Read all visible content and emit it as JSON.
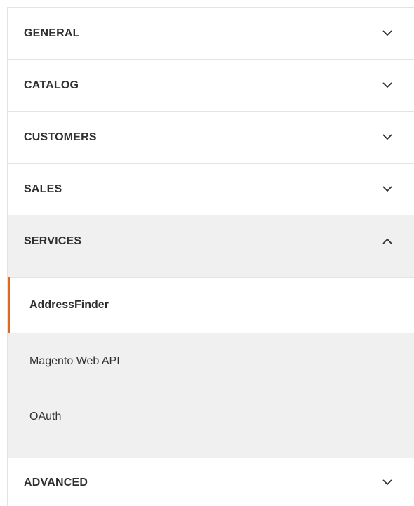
{
  "sections": [
    {
      "label": "GENERAL",
      "chevron": "chevron-down-icon"
    },
    {
      "label": "CATALOG",
      "chevron": "chevron-down-icon"
    },
    {
      "label": "CUSTOMERS",
      "chevron": "chevron-down-icon"
    },
    {
      "label": "SALES",
      "chevron": "chevron-down-icon"
    },
    {
      "label": "SERVICES",
      "chevron": "chevron-up-icon",
      "expanded": true
    },
    {
      "label": "ADVANCED",
      "chevron": "chevron-down-icon"
    }
  ],
  "services_items": [
    {
      "label": "AddressFinder",
      "active": true
    },
    {
      "label": "Magento Web API",
      "active": false
    },
    {
      "label": "OAuth",
      "active": false
    }
  ],
  "colors": {
    "accent": "#e0691c",
    "text": "#303030",
    "expanded_bg": "#f0f0f0",
    "border": "#e3e3e3"
  }
}
